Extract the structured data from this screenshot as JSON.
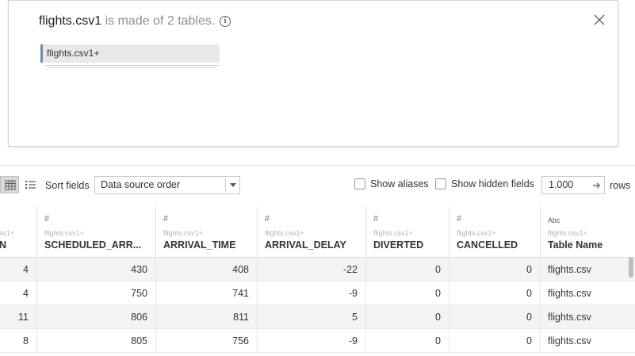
{
  "dialog": {
    "file_name": "flights.csv1",
    "subtitle": " is made of 2 tables.",
    "info_icon": "info-icon",
    "close_icon": "close-icon",
    "table_card_label": "flights.csv1+"
  },
  "toolbar": {
    "view_grid_icon": "grid-view-icon",
    "view_list_icon": "list-view-icon",
    "sort_label": "Sort fields",
    "sort_value": "Data source order",
    "show_aliases_label": "Show aliases",
    "show_aliases_checked": false,
    "show_hidden_label": "Show hidden fields",
    "show_hidden_checked": false,
    "rows_value": "1.000",
    "rows_arrow_icon": "arrow-right-icon",
    "rows_label": "rows"
  },
  "grid": {
    "columns": [
      {
        "type": "",
        "source": "sv1+",
        "name": "N"
      },
      {
        "type": "#",
        "source": "flights.csv1+",
        "name": "SCHEDULED_ARR..."
      },
      {
        "type": "#",
        "source": "flights.csv1+",
        "name": "ARRIVAL_TIME"
      },
      {
        "type": "#",
        "source": "flights.csv1+",
        "name": "ARRIVAL_DELAY"
      },
      {
        "type": "#",
        "source": "flights.csv1+",
        "name": "DIVERTED"
      },
      {
        "type": "#",
        "source": "flights.csv1+",
        "name": "CANCELLED"
      },
      {
        "type": "Abc",
        "source": "flights.csv1+",
        "name": "Table Name"
      }
    ],
    "rows": [
      [
        "4",
        "430",
        "408",
        "-22",
        "0",
        "0",
        "flights.csv"
      ],
      [
        "4",
        "750",
        "741",
        "-9",
        "0",
        "0",
        "flights.csv"
      ],
      [
        "11",
        "806",
        "811",
        "5",
        "0",
        "0",
        "flights.csv"
      ],
      [
        "8",
        "805",
        "756",
        "-9",
        "0",
        "0",
        "flights.csv"
      ]
    ]
  }
}
